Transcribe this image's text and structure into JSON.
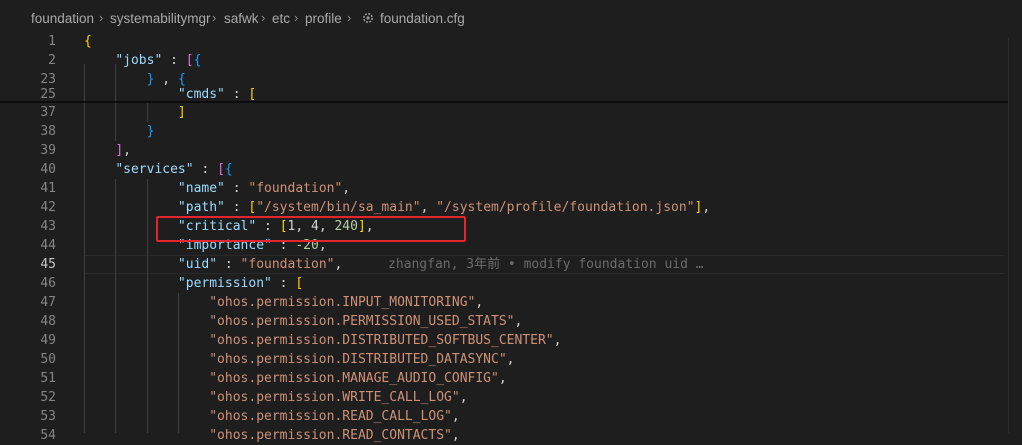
{
  "breadcrumb": {
    "items": [
      "foundation",
      "systemabilitymgr",
      "safwk",
      "etc",
      "profile",
      "foundation.cfg"
    ],
    "icon": "gear-icon"
  },
  "editor": {
    "active_line": "45",
    "blame": "zhangfan, 3年前 • modify foundation uid …",
    "lines": [
      {
        "num": "1",
        "code": "{"
      },
      {
        "num": "2",
        "code": "    \"jobs\" : [{"
      },
      {
        "num": "23",
        "code": "        } , {"
      },
      {
        "num": "25",
        "code": "            \"cmds\" : ["
      },
      {
        "num": "37",
        "code": "            ]"
      },
      {
        "num": "38",
        "code": "        }"
      },
      {
        "num": "39",
        "code": "    ],"
      },
      {
        "num": "40",
        "code": "    \"services\" : [{"
      },
      {
        "num": "41",
        "code": "            \"name\" : \"foundation\","
      },
      {
        "num": "42",
        "code": "            \"path\" : [\"/system/bin/sa_main\", \"/system/profile/foundation.json\"],"
      },
      {
        "num": "43",
        "code": "            \"critical\" : [1, 4, 240],"
      },
      {
        "num": "44",
        "code": "            \"importance\" : -20,"
      },
      {
        "num": "45",
        "code": "            \"uid\" : \"foundation\","
      },
      {
        "num": "46",
        "code": "            \"permission\" : ["
      },
      {
        "num": "47",
        "code": "                \"ohos.permission.INPUT_MONITORING\","
      },
      {
        "num": "48",
        "code": "                \"ohos.permission.PERMISSION_USED_STATS\","
      },
      {
        "num": "49",
        "code": "                \"ohos.permission.DISTRIBUTED_SOFTBUS_CENTER\","
      },
      {
        "num": "50",
        "code": "                \"ohos.permission.DISTRIBUTED_DATASYNC\","
      },
      {
        "num": "51",
        "code": "                \"ohos.permission.MANAGE_AUDIO_CONFIG\","
      },
      {
        "num": "52",
        "code": "                \"ohos.permission.WRITE_CALL_LOG\","
      },
      {
        "num": "53",
        "code": "                \"ohos.permission.READ_CALL_LOG\","
      },
      {
        "num": "54",
        "code": "                \"ohos.permission.READ_CONTACTS\","
      }
    ]
  }
}
